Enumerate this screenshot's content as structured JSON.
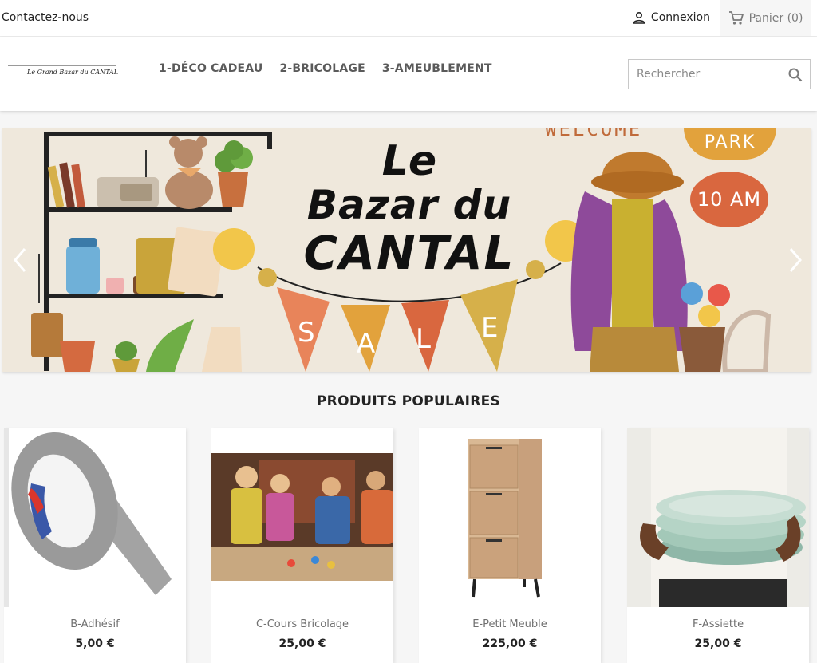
{
  "topbar": {
    "contact": "Contactez-nous",
    "login": "Connexion",
    "cart": "Panier (0)"
  },
  "header": {
    "logo_text": "Le Grand Bazar du CANTAL",
    "menu": [
      "1-DÉCO CADEAU",
      "2-BRICOLAGE",
      "3-AMEUBLEMENT"
    ],
    "search_placeholder": "Rechercher"
  },
  "banner": {
    "title_line1": "Le",
    "title_line2": "Bazar du",
    "title_line3": "CANTAL",
    "welcome": "WELCOME",
    "park": "PARK",
    "time": "10 AM",
    "flags": [
      "S",
      "A",
      "L",
      "E"
    ]
  },
  "section_title": "PRODUITS POPULAIRES",
  "products": [
    {
      "name": "B-Adhésif",
      "price": "5,00 €"
    },
    {
      "name": "C-Cours Bricolage",
      "price": "25,00 €"
    },
    {
      "name": "E-Petit Meuble",
      "price": "225,00 €"
    },
    {
      "name": "F-Assiette",
      "price": "25,00 €"
    }
  ],
  "icons": {
    "user": "user-icon",
    "cart": "shopping-cart-icon",
    "search": "search-icon",
    "prev": "chevron-left-icon",
    "next": "chevron-right-icon"
  },
  "colors": {
    "accent_orange": "#e2a23c",
    "accent_red": "#d9673f",
    "banner_bg": "#efe8dc",
    "menu_text": "#5a5a5a"
  }
}
